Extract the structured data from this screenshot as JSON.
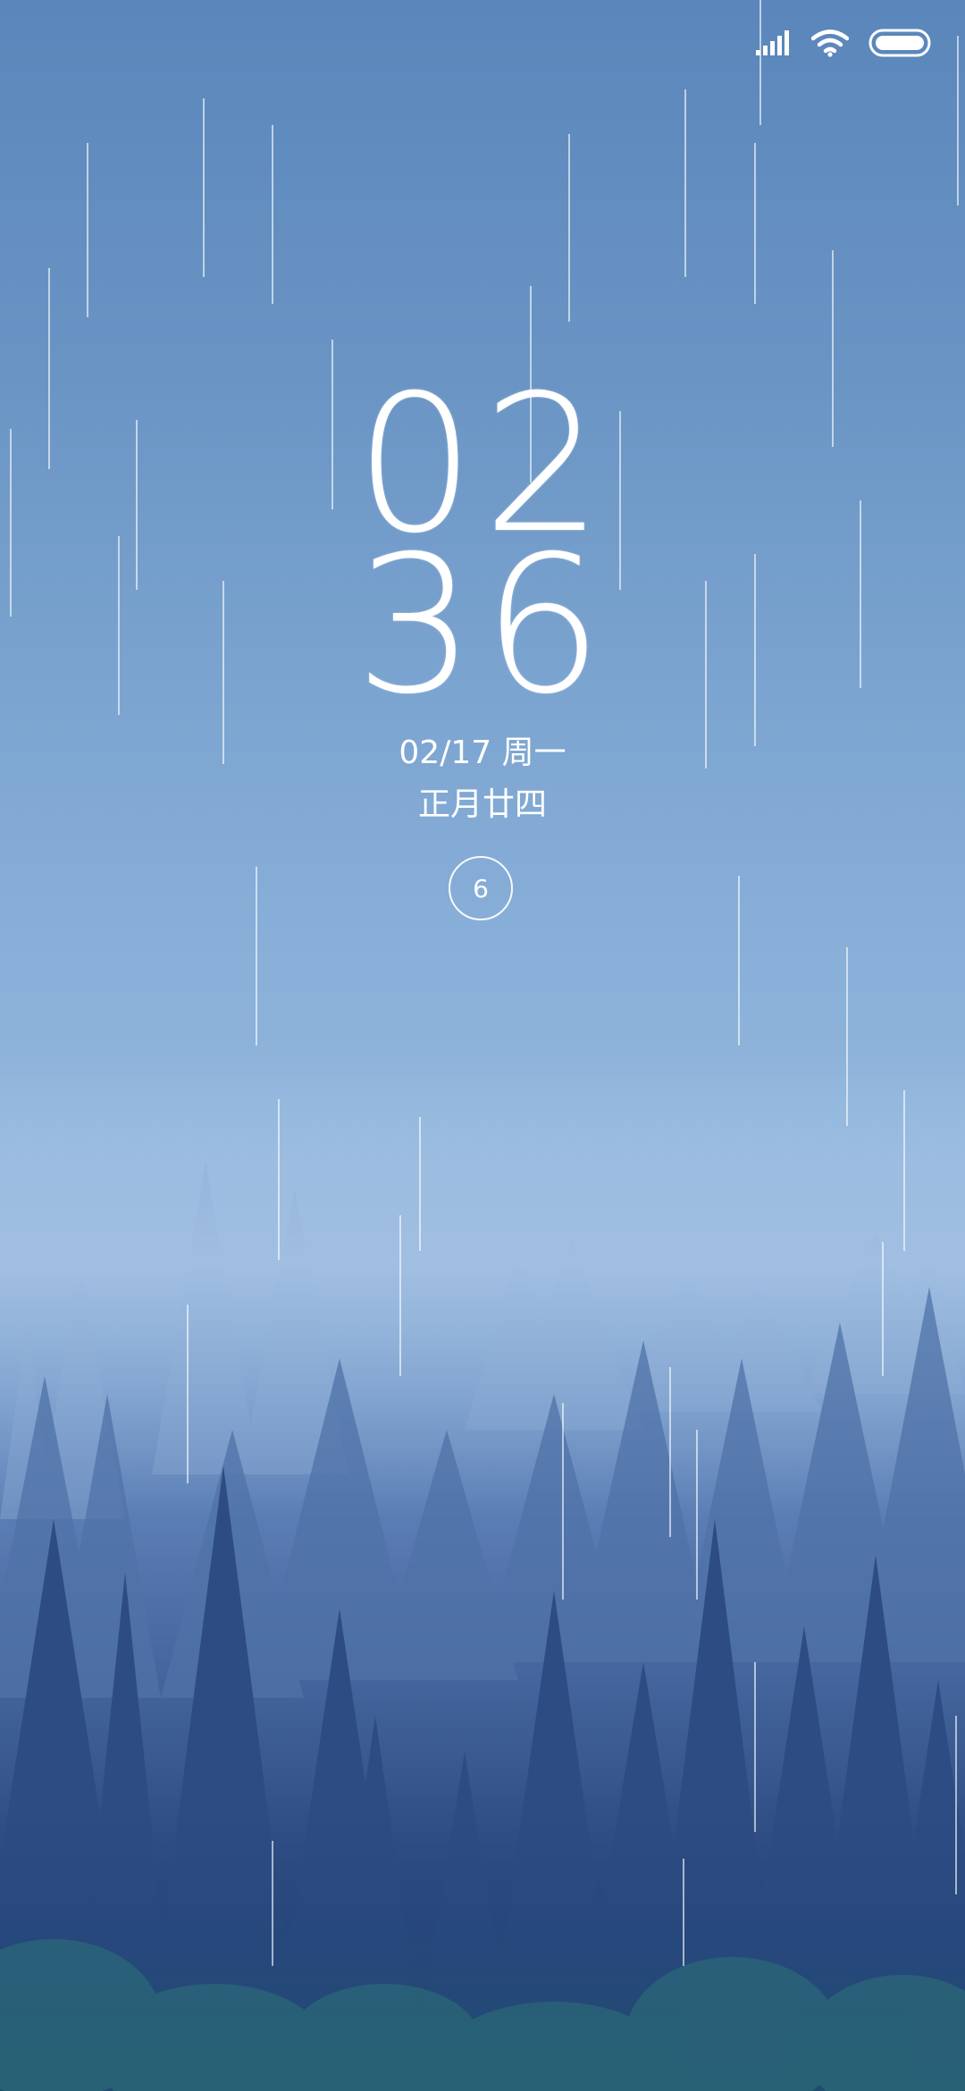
{
  "lockscreen": {
    "hour": "02",
    "minute": "36",
    "date": "02/17 周一",
    "lunar_date": "正月廿四",
    "notification_count": "6"
  },
  "status_bar": {
    "icons": [
      "signal-icon",
      "wifi-icon",
      "battery-icon"
    ]
  },
  "wallpaper": {
    "subject": "misty pine forest with rain",
    "sky_color": "#6a94c4",
    "forest_color": "#2c4a80"
  }
}
